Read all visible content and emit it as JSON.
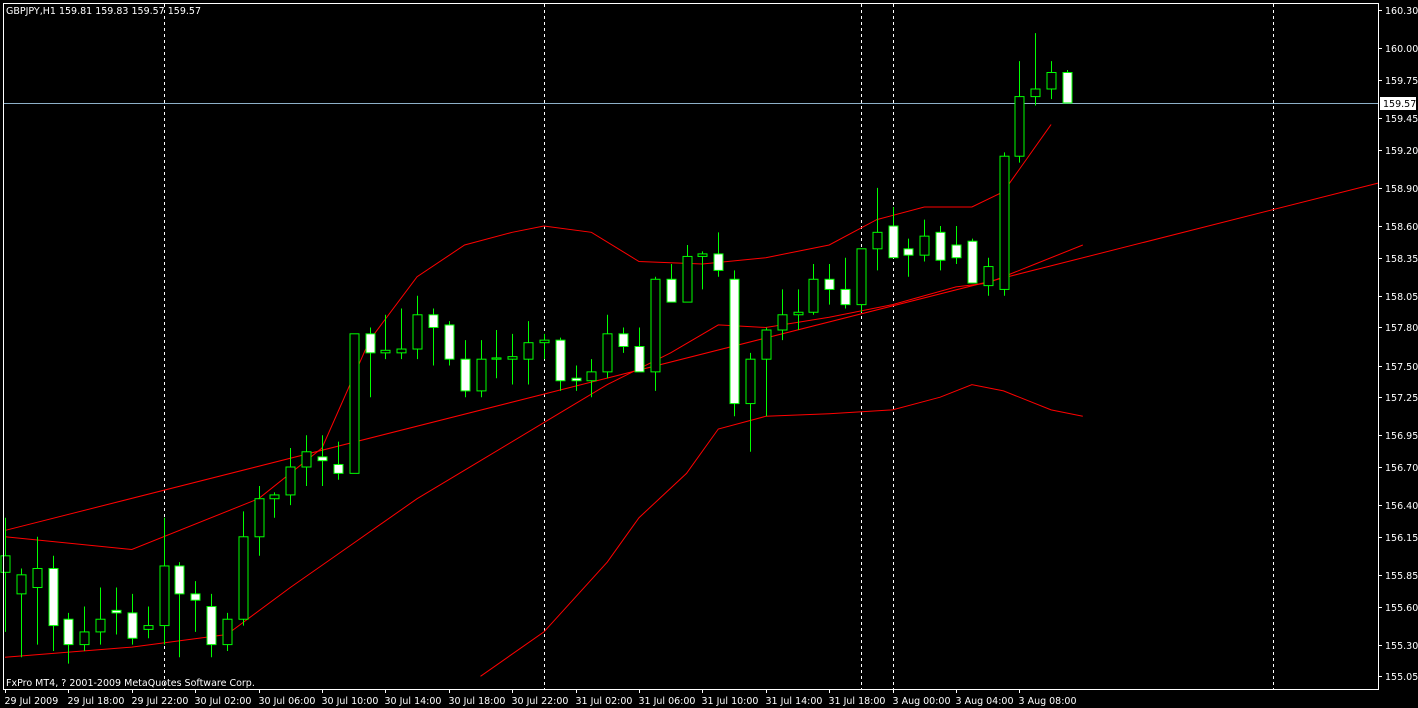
{
  "window": {
    "header": "GBPJPY,H1  159.81 159.83 159.57 159.57",
    "footer": "FxPro MT4, ? 2001-2009 MetaQuotes Software Corp."
  },
  "chart_data": {
    "type": "candlestick",
    "symbol": "GBPJPY",
    "timeframe": "H1",
    "ylim": [
      154.95,
      160.35
    ],
    "grid": false,
    "current_price": 159.57,
    "current_price_label": "159.57",
    "y_ticks": [
      "160.30",
      "160.00",
      "159.75",
      "159.45",
      "159.20",
      "158.90",
      "158.60",
      "158.35",
      "158.05",
      "157.80",
      "157.50",
      "157.25",
      "156.95",
      "156.70",
      "156.40",
      "156.15",
      "155.85",
      "155.60",
      "155.30",
      "155.05"
    ],
    "y_tick_values": [
      160.3,
      160.0,
      159.75,
      159.45,
      159.2,
      158.9,
      158.6,
      158.35,
      158.05,
      157.8,
      157.5,
      157.25,
      156.95,
      156.7,
      156.4,
      156.15,
      155.85,
      155.6,
      155.3,
      155.05
    ],
    "x_ticks": [
      "29 Jul 2009",
      "29 Jul 18:00",
      "29 Jul 22:00",
      "30 Jul 02:00",
      "30 Jul 06:00",
      "30 Jul 10:00",
      "30 Jul 14:00",
      "30 Jul 18:00",
      "30 Jul 22:00",
      "31 Jul 02:00",
      "31 Jul 06:00",
      "31 Jul 10:00",
      "31 Jul 14:00",
      "31 Jul 18:00",
      "3 Aug 00:00",
      "3 Aug 04:00",
      "3 Aug 08:00"
    ],
    "x_tick_bar_index": [
      0,
      4,
      8,
      12,
      16,
      20,
      24,
      28,
      32,
      36,
      40,
      44,
      48,
      52,
      56,
      60,
      64
    ],
    "day_separators_bar_index": [
      10,
      34,
      54,
      56,
      80
    ],
    "candles": [
      {
        "o": 155.87,
        "h": 156.3,
        "l": 155.4,
        "c": 156.0
      },
      {
        "o": 155.7,
        "h": 155.9,
        "l": 155.2,
        "c": 155.85
      },
      {
        "o": 155.75,
        "h": 156.15,
        "l": 155.3,
        "c": 155.9
      },
      {
        "o": 155.9,
        "h": 156.0,
        "l": 155.25,
        "c": 155.45
      },
      {
        "o": 155.5,
        "h": 155.55,
        "l": 155.15,
        "c": 155.3
      },
      {
        "o": 155.3,
        "h": 155.6,
        "l": 155.25,
        "c": 155.4
      },
      {
        "o": 155.4,
        "h": 155.75,
        "l": 155.3,
        "c": 155.5
      },
      {
        "o": 155.57,
        "h": 155.75,
        "l": 155.38,
        "c": 155.55
      },
      {
        "o": 155.55,
        "h": 155.7,
        "l": 155.3,
        "c": 155.35
      },
      {
        "o": 155.42,
        "h": 155.6,
        "l": 155.35,
        "c": 155.45
      },
      {
        "o": 155.45,
        "h": 156.3,
        "l": 155.3,
        "c": 155.92
      },
      {
        "o": 155.92,
        "h": 155.95,
        "l": 155.2,
        "c": 155.7
      },
      {
        "o": 155.7,
        "h": 155.8,
        "l": 155.4,
        "c": 155.65
      },
      {
        "o": 155.6,
        "h": 155.7,
        "l": 155.2,
        "c": 155.3
      },
      {
        "o": 155.3,
        "h": 155.55,
        "l": 155.25,
        "c": 155.5
      },
      {
        "o": 155.5,
        "h": 156.35,
        "l": 155.45,
        "c": 156.15
      },
      {
        "o": 156.15,
        "h": 156.55,
        "l": 156.0,
        "c": 156.45
      },
      {
        "o": 156.45,
        "h": 156.5,
        "l": 156.3,
        "c": 156.48
      },
      {
        "o": 156.48,
        "h": 156.85,
        "l": 156.4,
        "c": 156.7
      },
      {
        "o": 156.7,
        "h": 156.95,
        "l": 156.55,
        "c": 156.82
      },
      {
        "o": 156.78,
        "h": 156.95,
        "l": 156.55,
        "c": 156.75
      },
      {
        "o": 156.72,
        "h": 156.9,
        "l": 156.6,
        "c": 156.65
      },
      {
        "o": 156.65,
        "h": 157.75,
        "l": 156.65,
        "c": 157.75
      },
      {
        "o": 157.75,
        "h": 157.8,
        "l": 157.25,
        "c": 157.6
      },
      {
        "o": 157.6,
        "h": 157.9,
        "l": 157.55,
        "c": 157.62
      },
      {
        "o": 157.6,
        "h": 157.95,
        "l": 157.55,
        "c": 157.63
      },
      {
        "o": 157.63,
        "h": 158.05,
        "l": 157.55,
        "c": 157.9
      },
      {
        "o": 157.9,
        "h": 157.95,
        "l": 157.5,
        "c": 157.8
      },
      {
        "o": 157.82,
        "h": 157.85,
        "l": 157.5,
        "c": 157.55
      },
      {
        "o": 157.55,
        "h": 157.7,
        "l": 157.25,
        "c": 157.3
      },
      {
        "o": 157.3,
        "h": 157.7,
        "l": 157.25,
        "c": 157.55
      },
      {
        "o": 157.55,
        "h": 157.78,
        "l": 157.4,
        "c": 157.56
      },
      {
        "o": 157.55,
        "h": 157.75,
        "l": 157.35,
        "c": 157.57
      },
      {
        "o": 157.55,
        "h": 157.85,
        "l": 157.35,
        "c": 157.68
      },
      {
        "o": 157.68,
        "h": 157.75,
        "l": 157.55,
        "c": 157.7
      },
      {
        "o": 157.7,
        "h": 157.72,
        "l": 157.3,
        "c": 157.38
      },
      {
        "o": 157.4,
        "h": 157.5,
        "l": 157.3,
        "c": 157.38
      },
      {
        "o": 157.38,
        "h": 157.55,
        "l": 157.25,
        "c": 157.45
      },
      {
        "o": 157.45,
        "h": 157.9,
        "l": 157.4,
        "c": 157.75
      },
      {
        "o": 157.75,
        "h": 157.8,
        "l": 157.6,
        "c": 157.65
      },
      {
        "o": 157.65,
        "h": 157.8,
        "l": 157.45,
        "c": 157.45
      },
      {
        "o": 157.45,
        "h": 158.2,
        "l": 157.3,
        "c": 158.18
      },
      {
        "o": 158.18,
        "h": 158.3,
        "l": 158.0,
        "c": 158.0
      },
      {
        "o": 158.0,
        "h": 158.45,
        "l": 158.0,
        "c": 158.36
      },
      {
        "o": 158.36,
        "h": 158.4,
        "l": 158.1,
        "c": 158.38
      },
      {
        "o": 158.38,
        "h": 158.55,
        "l": 158.2,
        "c": 158.25
      },
      {
        "o": 158.18,
        "h": 158.25,
        "l": 157.1,
        "c": 157.2
      },
      {
        "o": 157.2,
        "h": 157.6,
        "l": 156.82,
        "c": 157.55
      },
      {
        "o": 157.55,
        "h": 157.8,
        "l": 157.1,
        "c": 157.78
      },
      {
        "o": 157.78,
        "h": 158.1,
        "l": 157.7,
        "c": 157.9
      },
      {
        "o": 157.9,
        "h": 158.1,
        "l": 157.78,
        "c": 157.92
      },
      {
        "o": 157.92,
        "h": 158.3,
        "l": 157.9,
        "c": 158.18
      },
      {
        "o": 158.18,
        "h": 158.3,
        "l": 157.98,
        "c": 158.1
      },
      {
        "o": 158.1,
        "h": 158.35,
        "l": 157.95,
        "c": 157.98
      },
      {
        "o": 157.98,
        "h": 158.4,
        "l": 157.92,
        "c": 158.42
      },
      {
        "o": 158.42,
        "h": 158.9,
        "l": 158.25,
        "c": 158.55
      },
      {
        "o": 158.6,
        "h": 158.75,
        "l": 158.35,
        "c": 158.35
      },
      {
        "o": 158.42,
        "h": 158.5,
        "l": 158.2,
        "c": 158.37
      },
      {
        "o": 158.37,
        "h": 158.65,
        "l": 158.32,
        "c": 158.52
      },
      {
        "o": 158.55,
        "h": 158.6,
        "l": 158.25,
        "c": 158.33
      },
      {
        "o": 158.45,
        "h": 158.6,
        "l": 158.3,
        "c": 158.35
      },
      {
        "o": 158.48,
        "h": 158.5,
        "l": 158.15,
        "c": 158.15
      },
      {
        "o": 158.13,
        "h": 158.35,
        "l": 158.05,
        "c": 158.28
      },
      {
        "o": 158.1,
        "h": 159.18,
        "l": 158.05,
        "c": 159.15
      },
      {
        "o": 159.15,
        "h": 159.9,
        "l": 159.1,
        "c": 159.62
      },
      {
        "o": 159.62,
        "h": 160.12,
        "l": 159.55,
        "c": 159.68
      },
      {
        "o": 159.68,
        "h": 159.9,
        "l": 159.6,
        "c": 159.81
      },
      {
        "o": 159.81,
        "h": 159.83,
        "l": 159.57,
        "c": 159.57
      }
    ],
    "bollinger_upper": [
      [
        0,
        156.15
      ],
      [
        8,
        156.05
      ],
      [
        16,
        156.45
      ],
      [
        20,
        156.85
      ],
      [
        23,
        157.7
      ],
      [
        26,
        158.2
      ],
      [
        29,
        158.45
      ],
      [
        32,
        158.55
      ],
      [
        34,
        158.6
      ],
      [
        37,
        158.55
      ],
      [
        40,
        158.32
      ],
      [
        44,
        158.3
      ],
      [
        48,
        158.35
      ],
      [
        52,
        158.45
      ],
      [
        55,
        158.65
      ],
      [
        58,
        158.75
      ],
      [
        61,
        158.75
      ],
      [
        63,
        158.87
      ],
      [
        66,
        159.4
      ]
    ],
    "bollinger_middle": [
      [
        0,
        155.2
      ],
      [
        8,
        155.28
      ],
      [
        14,
        155.38
      ],
      [
        18,
        155.75
      ],
      [
        22,
        156.1
      ],
      [
        26,
        156.45
      ],
      [
        30,
        156.75
      ],
      [
        34,
        157.05
      ],
      [
        38,
        157.35
      ],
      [
        42,
        157.6
      ],
      [
        45,
        157.82
      ],
      [
        48,
        157.8
      ],
      [
        52,
        157.88
      ],
      [
        56,
        157.98
      ],
      [
        60,
        158.12
      ],
      [
        62,
        158.15
      ],
      [
        65,
        158.3
      ],
      [
        68,
        158.45
      ]
    ],
    "bollinger_lower": [
      [
        30,
        155.05
      ],
      [
        34,
        155.4
      ],
      [
        38,
        155.95
      ],
      [
        40,
        156.3
      ],
      [
        43,
        156.65
      ],
      [
        45,
        157.0
      ],
      [
        48,
        157.1
      ],
      [
        52,
        157.12
      ],
      [
        56,
        157.15
      ],
      [
        59,
        157.25
      ],
      [
        61,
        157.35
      ],
      [
        63,
        157.3
      ],
      [
        66,
        157.15
      ],
      [
        68,
        157.1
      ]
    ],
    "trendline": [
      [
        0,
        156.2
      ],
      [
        87,
        158.95
      ]
    ]
  }
}
